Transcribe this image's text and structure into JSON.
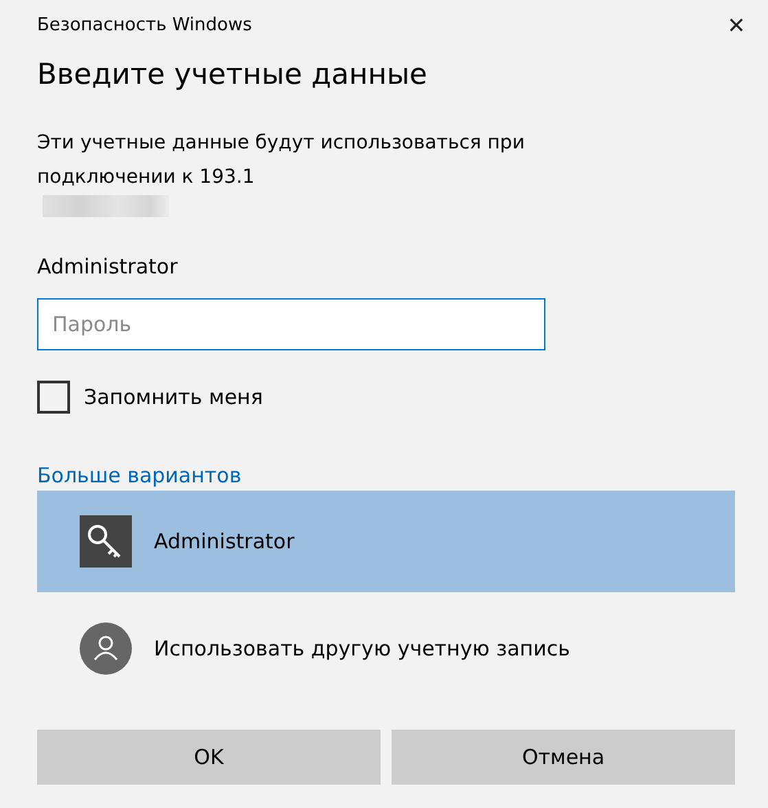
{
  "window": {
    "title": "Безопасность Windows",
    "close": "✕"
  },
  "heading": "Введите учетные данные",
  "description": "Эти учетные данные будут использоваться при подключении к 193.1",
  "username": "Administrator",
  "password": {
    "placeholder": "Пароль"
  },
  "remember": {
    "label": "Запомнить меня",
    "checked": false
  },
  "more_link": "Больше вариантов",
  "accounts": [
    {
      "kind": "key",
      "name": "Administrator",
      "selected": true
    },
    {
      "kind": "person",
      "name": "Использовать другую учетную запись",
      "selected": false
    }
  ],
  "buttons": [
    "OK",
    "Отмена"
  ]
}
